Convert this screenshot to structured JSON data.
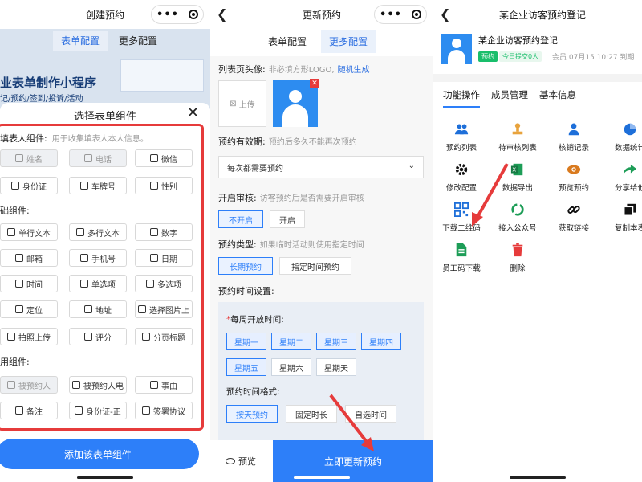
{
  "panel1": {
    "nav_title": "创建预约",
    "tabs": [
      "表单配置",
      "更多配置"
    ],
    "banner_title": "业表单制作小程序",
    "banner_subtitle": "记/预约/签到/投诉/活动",
    "sheet_title": "选择表单组件",
    "sections": [
      {
        "title": "填表人组件:",
        "hint": "用于收集填表人本人信息。",
        "items": [
          {
            "label": "姓名",
            "icon": "person-icon",
            "disabled": true
          },
          {
            "label": "电话",
            "icon": "phone-icon",
            "disabled": true
          },
          {
            "label": "微信",
            "icon": "wechat-icon",
            "disabled": false
          },
          {
            "label": "身份证",
            "icon": "idcard-icon",
            "disabled": false
          },
          {
            "label": "车牌号",
            "icon": "car-icon",
            "disabled": false
          },
          {
            "label": "性别",
            "icon": "gender-icon",
            "disabled": false
          }
        ]
      },
      {
        "title": "础组件:",
        "hint": "",
        "items": [
          {
            "label": "单行文本",
            "icon": "text-icon",
            "disabled": false
          },
          {
            "label": "多行文本",
            "icon": "textarea-icon",
            "disabled": false
          },
          {
            "label": "数字",
            "icon": "number-icon",
            "disabled": false
          },
          {
            "label": "邮箱",
            "icon": "mail-icon",
            "disabled": false
          },
          {
            "label": "手机号",
            "icon": "mobile-icon",
            "disabled": false
          },
          {
            "label": "日期",
            "icon": "calendar-icon",
            "disabled": false
          },
          {
            "label": "时间",
            "icon": "clock-icon",
            "disabled": false
          },
          {
            "label": "单选项",
            "icon": "radio-icon",
            "disabled": false
          },
          {
            "label": "多选项",
            "icon": "checkbox-icon",
            "disabled": false
          },
          {
            "label": "定位",
            "icon": "location-icon",
            "disabled": false
          },
          {
            "label": "地址",
            "icon": "address-icon",
            "disabled": false
          },
          {
            "label": "选择图片上",
            "icon": "image-icon",
            "disabled": false
          },
          {
            "label": "拍照上传",
            "icon": "camera-icon",
            "disabled": false
          },
          {
            "label": "评分",
            "icon": "star-icon",
            "disabled": false
          },
          {
            "label": "分页标题",
            "icon": "page-title-icon",
            "disabled": false
          }
        ]
      },
      {
        "title": "用组件:",
        "hint": "",
        "items": [
          {
            "label": "被预约人",
            "icon": "person-icon",
            "disabled": true
          },
          {
            "label": "被预约人电",
            "icon": "phone-icon",
            "disabled": false
          },
          {
            "label": "事由",
            "icon": "reason-icon",
            "disabled": false
          },
          {
            "label": "备注",
            "icon": "note-icon",
            "disabled": false
          },
          {
            "label": "身份证-正",
            "icon": "idcard-icon",
            "disabled": false
          },
          {
            "label": "签署协议",
            "icon": "sign-icon",
            "disabled": false
          }
        ]
      }
    ],
    "add_button": "添加该表单组件"
  },
  "panel2": {
    "nav_title": "更新预约",
    "tabs": [
      "表单配置",
      "更多配置"
    ],
    "avatar_label": "列表页头像:",
    "avatar_hint": "非必填方形LOGO,",
    "avatar_link": "随机生成",
    "upload_label": "上传",
    "validity_label": "预约有效期:",
    "validity_hint": "预约后多久不能再次预约",
    "validity_value": "每次都需要预约",
    "audit_label": "开启审核:",
    "audit_hint": "访客预约后是否需要开启审核",
    "audit_options": [
      "不开启",
      "开启"
    ],
    "type_label": "预约类型:",
    "type_hint": "如果临时活动则使用指定时间",
    "type_options": [
      "长期预约",
      "指定时间预约"
    ],
    "time_setting_label": "预约时间设置:",
    "weekly_label": "每周开放时间:",
    "days": [
      {
        "label": "星期一",
        "selected": true
      },
      {
        "label": "星期二",
        "selected": true
      },
      {
        "label": "星期三",
        "selected": true
      },
      {
        "label": "星期四",
        "selected": true
      },
      {
        "label": "星期五",
        "selected": true
      },
      {
        "label": "星期六",
        "selected": false
      },
      {
        "label": "星期天",
        "selected": false
      }
    ],
    "format_label": "预约时间格式:",
    "format_options": [
      "按天预约",
      "固定时长",
      "自选时间"
    ],
    "preview_label": "预览",
    "update_button": "立即更新预约"
  },
  "panel3": {
    "nav_title": "某企业访客预约登记",
    "card_title": "某企业访客预约登记",
    "badge": "预约",
    "count_badge": "今日提交0人",
    "meta": "会员 07月15 10:27 到期",
    "tabs": [
      "功能操作",
      "成员管理",
      "基本信息"
    ],
    "functions": [
      {
        "label": "预约列表",
        "icon": "members-icon",
        "color": "#1e6fd9"
      },
      {
        "label": "待审核列表",
        "icon": "stamp-icon",
        "color": "#e8a33d"
      },
      {
        "label": "核销记录",
        "icon": "user-check-icon",
        "color": "#1e6fd9"
      },
      {
        "label": "数据统计",
        "icon": "pie-chart-icon",
        "color": "#1e6fd9"
      },
      {
        "label": "修改配置",
        "icon": "gear-icon",
        "color": "#111111"
      },
      {
        "label": "数据导出",
        "icon": "excel-icon",
        "color": "#1d9d57"
      },
      {
        "label": "预览预约",
        "icon": "eye-icon",
        "color": "#d97a1e"
      },
      {
        "label": "分享给他",
        "icon": "share-icon",
        "color": "#1d9d57"
      },
      {
        "label": "下载二维码",
        "icon": "qrcode-icon",
        "color": "#1e6fd9"
      },
      {
        "label": "接入公众号",
        "icon": "wechat-official-icon",
        "color": "#1d9d57"
      },
      {
        "label": "获取链接",
        "icon": "link-icon",
        "color": "#111111"
      },
      {
        "label": "复制本表",
        "icon": "copy-icon",
        "color": "#111111"
      },
      {
        "label": "员工码下载",
        "icon": "file-icon",
        "color": "#1d9d57"
      },
      {
        "label": "删除",
        "icon": "trash-icon",
        "color": "#e63b3b"
      }
    ]
  },
  "colors": {
    "accent": "#2d7ff9",
    "highlight_red": "#e63b3b",
    "green": "#19be6b"
  }
}
